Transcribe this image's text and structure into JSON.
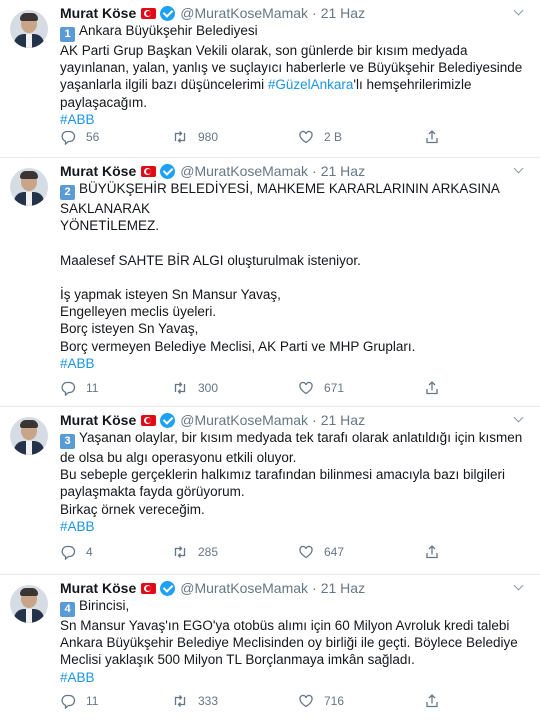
{
  "tweets": [
    {
      "author": "Murat Köse",
      "handle": "@MuratKoseMamak",
      "dot": "·",
      "time": "21 Haz",
      "number": "1",
      "lines": [
        {
          "a": "Ankara Büyükşehir Belediyesi"
        },
        {
          "a": "AK Parti Grup Başkan Vekili olarak, son günlerde bir kısım medyada"
        },
        {
          "a": "yayınlanan, yalan, yanlış ve suçlayıcı haberlerle ve Büyükşehir Belediyesinde"
        },
        {
          "a": "yaşanlarla ilgili bazı düşüncelerimi ",
          "link": "#GüzelAnkara",
          "b": "'lı hemşehrilerimizle"
        },
        {
          "a": "paylaşacağım."
        }
      ],
      "hashtag": "#ABB",
      "replies": "56",
      "retweets": "980",
      "likes": "2 B"
    },
    {
      "author": "Murat Köse",
      "handle": "@MuratKoseMamak",
      "dot": "·",
      "time": "21 Haz",
      "number": "2",
      "lines": [
        {
          "a": "BÜYÜKŞEHİR BELEDİYESİ, MAHKEME KARARLARININ ARKASINA"
        },
        {
          "a": "SAKLANARAK"
        },
        {
          "a": "YÖNETİLEMEZ."
        },
        {
          "a": ""
        },
        {
          "a": "Maalesef SAHTE BİR ALGI oluşturulmak isteniyor."
        },
        {
          "a": ""
        },
        {
          "a": "İş yapmak isteyen Sn Mansur Yavaş,"
        },
        {
          "a": "Engelleyen meclis üyeleri."
        },
        {
          "a": "Borç isteyen Sn Yavaş,"
        },
        {
          "a": "Borç vermeyen Belediye Meclisi, AK Parti ve MHP Grupları."
        }
      ],
      "hashtag": "#ABB",
      "replies": "11",
      "retweets": "300",
      "likes": "671"
    },
    {
      "author": "Murat Köse",
      "handle": "@MuratKoseMamak",
      "dot": "·",
      "time": "21 Haz",
      "number": "3",
      "lines": [
        {
          "a": "Yaşanan olaylar, bir kısım medyada tek tarafı olarak anlatıldığı için kısmen"
        },
        {
          "a": "de olsa bu algı operasyonu etkili oluyor."
        },
        {
          "a": "Bu sebeple gerçeklerin halkımız tarafından bilinmesi amacıyla bazı bilgileri"
        },
        {
          "a": "paylaşmakta fayda görüyorum."
        },
        {
          "a": "Birkaç örnek vereceğim."
        }
      ],
      "hashtag": "#ABB",
      "replies": "4",
      "retweets": "285",
      "likes": "647"
    },
    {
      "author": "Murat Köse",
      "handle": "@MuratKoseMamak",
      "dot": "·",
      "time": "21 Haz",
      "number": "4",
      "lines": [
        {
          "a": "Birincisi,"
        },
        {
          "a": " Sn Mansur Yavaş'ın EGO'ya otobüs alımı için 60 Milyon Avroluk kredi talebi"
        },
        {
          "a": "Ankara Büyükşehir Belediye Meclisinden oy birliği ile geçti. Böylece Belediye"
        },
        {
          "a": "Meclisi yaklaşık 500 Milyon TL Borçlanmaya imkân sağladı."
        }
      ],
      "hashtag": "#ABB",
      "replies": "11",
      "retweets": "333",
      "likes": "716"
    }
  ],
  "icons": {
    "reply": "reply-icon",
    "retweet": "retweet-icon",
    "like": "heart-icon",
    "share": "share-icon",
    "verified": "verified-badge-icon",
    "flag": "turkish-flag-icon",
    "more": "chevron-down-icon"
  },
  "colors": {
    "link": "#1b95e0",
    "verified": "#1da1f2",
    "muted": "#657786",
    "number_badge": "#5b9bd5"
  }
}
